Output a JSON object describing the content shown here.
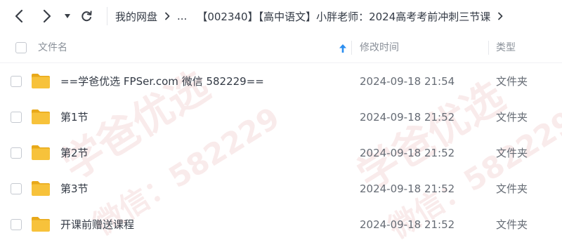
{
  "toolbar": {
    "back_icon": "chevron-left-icon",
    "forward_icon": "chevron-right-icon",
    "history_icon": "caret-down-icon",
    "refresh_icon": "refresh-icon"
  },
  "breadcrumb": {
    "root": "我的网盘",
    "ellipsis": "...",
    "current": "【002340】【高中语文】小胖老师：2024高考考前冲刺三节课"
  },
  "table": {
    "columns": {
      "name": "文件名",
      "modified": "修改时间",
      "type": "类型"
    },
    "sort_icon": "sort-arrow-up-icon",
    "rows": [
      {
        "name": "==学爸优选 FPSer.com 微信 582229==",
        "modified": "2024-09-18 21:54",
        "type": "文件夹"
      },
      {
        "name": "第1节",
        "modified": "2024-09-18 21:52",
        "type": "文件夹"
      },
      {
        "name": "第2节",
        "modified": "2024-09-18 21:52",
        "type": "文件夹"
      },
      {
        "name": "第3节",
        "modified": "2024-09-18 21:52",
        "type": "文件夹"
      },
      {
        "name": "开课前赠送课程",
        "modified": "2024-09-18 21:52",
        "type": "文件夹"
      }
    ]
  },
  "watermarks": {
    "line1": "学爸优选",
    "line2": "微信：582229"
  },
  "colors": {
    "folder": "#f7c23b",
    "folder_tab": "#e8a91a",
    "sort_arrow": "#2b8ef0",
    "watermark": "#c83c3c"
  }
}
